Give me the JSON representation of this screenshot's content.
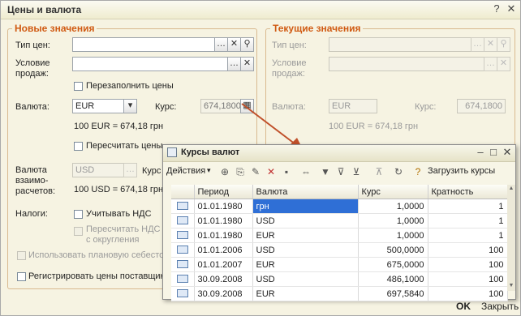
{
  "window": {
    "title": "Цены и валюта"
  },
  "new_values": {
    "legend": "Новые значения",
    "price_type_label": "Тип цен:",
    "sale_condition_label": "Условие продаж:",
    "refill_prices_label": "Перезаполнить цены",
    "currency_label": "Валюта:",
    "currency_value": "EUR",
    "rate_label": "Курс:",
    "rate_value": "674,1800",
    "rate_note": "100 EUR = 674,18 грн",
    "recalc_prices_label": "Пересчитать цены",
    "settlement_currency_label": "Валюта взаимо-расчетов:",
    "settlement_currency_value": "USD",
    "settlement_rate_label": "Курс",
    "settlement_note": "100 USD = 674,18 грн",
    "taxes_label": "Налоги:",
    "account_vat_label": "Учитывать НДС",
    "recalc_vat_label": "Пересчитать НДС с округления",
    "use_planned_cost_label": "Использовать плановую себестои",
    "register_supplier_prices_label": "Регистрировать цены поставщик"
  },
  "current_values": {
    "legend": "Текущие значения",
    "price_type_label": "Тип цен:",
    "sale_condition_label": "Условие продаж:",
    "currency_label": "Валюта:",
    "currency_value": "EUR",
    "rate_label": "Курс:",
    "rate_value": "674,1800",
    "rate_note": "100 EUR = 674,18 грн"
  },
  "rates_window": {
    "title": "Курсы валют",
    "actions_label": "Действия",
    "load_rates_label": "Загрузить курсы",
    "columns": [
      "Период",
      "Валюта",
      "Курс",
      "Кратность"
    ],
    "rows": [
      {
        "period": "01.01.1980",
        "currency": "грн",
        "rate": "1,0000",
        "multiplicity": "1"
      },
      {
        "period": "01.01.1980",
        "currency": "USD",
        "rate": "1,0000",
        "multiplicity": "1"
      },
      {
        "period": "01.01.1980",
        "currency": "EUR",
        "rate": "1,0000",
        "multiplicity": "1"
      },
      {
        "period": "01.01.2006",
        "currency": "USD",
        "rate": "500,0000",
        "multiplicity": "100"
      },
      {
        "period": "01.01.2007",
        "currency": "EUR",
        "rate": "675,0000",
        "multiplicity": "100"
      },
      {
        "period": "30.09.2008",
        "currency": "USD",
        "rate": "486,1000",
        "multiplicity": "100"
      },
      {
        "period": "30.09.2008",
        "currency": "EUR",
        "rate": "697,5840",
        "multiplicity": "100"
      }
    ]
  },
  "footer": {
    "ok_label": "OK",
    "close_label": "Закрыть"
  },
  "colors": {
    "accent": "#d05a12",
    "selection": "#2f6fd6",
    "arrow": "#c0502a"
  }
}
